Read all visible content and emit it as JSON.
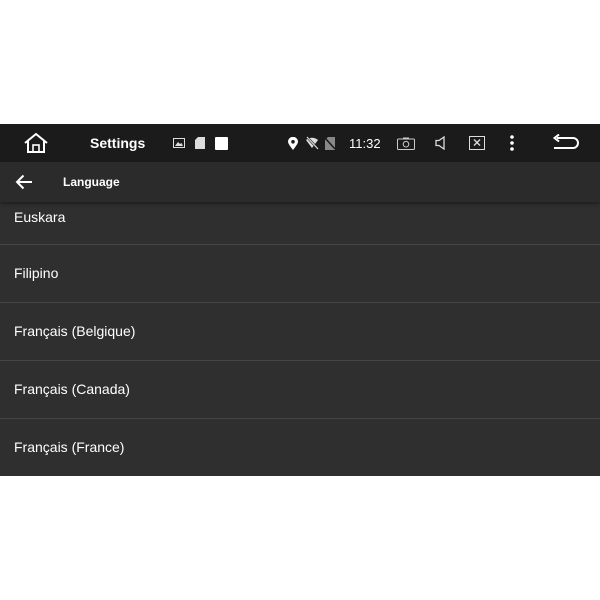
{
  "status_bar": {
    "app_title": "Settings",
    "time": "11:32",
    "icons": [
      "home-icon",
      "image-icon",
      "sd-card-icon",
      "square-icon",
      "location-icon",
      "wifi-off-icon",
      "no-sim-icon",
      "camera-icon",
      "volume-icon",
      "close-window-icon",
      "more-vert-icon",
      "back-arrow-icon"
    ]
  },
  "toolbar": {
    "title": "Language"
  },
  "languages": [
    "Euskara",
    "Filipino",
    "Français (Belgique)",
    "Français (Canada)",
    "Français (France)"
  ],
  "colors": {
    "status_bar_bg": "#1b1b1b",
    "toolbar_bg": "#2b2b2b",
    "list_bg": "#2f2f2f",
    "divider": "#454545",
    "text": "#ffffff"
  }
}
